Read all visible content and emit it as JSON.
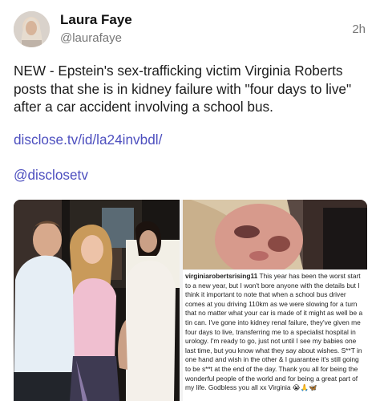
{
  "post": {
    "author_name": "Laura Faye",
    "author_handle": "@laurafaye",
    "timestamp": "2h",
    "text": "NEW - Epstein's sex-trafficking victim Virginia Roberts posts that she is in kidney failure with \"four days to live\" after a car accident involving a school bus.",
    "link_text": "disclose.tv/id/la24invbdl/",
    "mention": "@disclosetv",
    "link_color": "#4d4fbf"
  },
  "media": {
    "caption_username": "virginiarobertsrising11",
    "caption_text": " This year has been the worst start to a new year, but I won't bore anyone with the details but I think it important to note that when a school bus driver comes at you driving 110km as we were slowing for a turn that no matter what your car is made of it might as well be a tin can. I've gone into kidney renal failure, they've given me four days to live, transferring me to a specialist hospital in urology. I'm ready to go, just not until I see my babies one last time, but you know what they say about wishes. S**T in one hand and wish in the other & I guarantee it's still going to be s**t at the end of the day. Thank you all for being the wonderful people of the world and for being a great part of my life. Godbless you all xx Virginia 😭🙏🦋"
  }
}
